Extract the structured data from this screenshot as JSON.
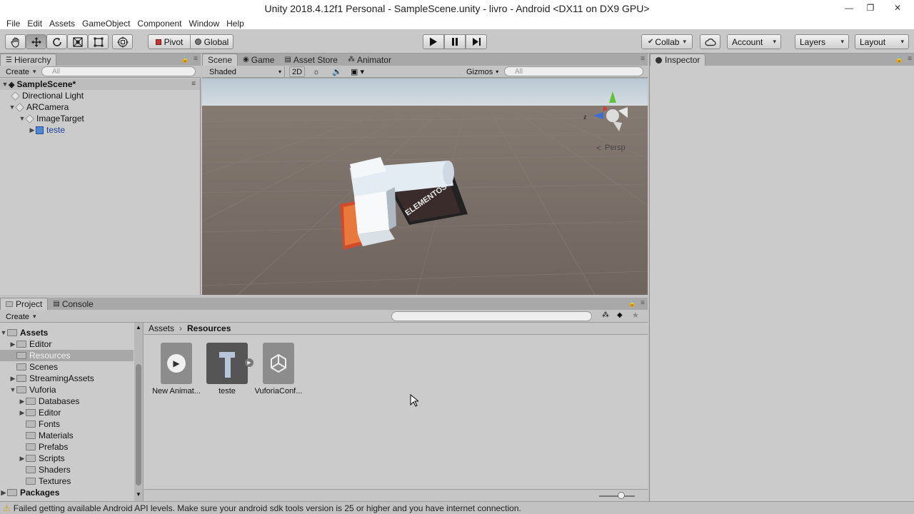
{
  "window": {
    "title": "Unity 2018.4.12f1 Personal - SampleScene.unity - livro - Android <DX11 on DX9 GPU>",
    "controls": [
      "—",
      "❐",
      "✕"
    ]
  },
  "menu": [
    "File",
    "Edit",
    "Assets",
    "GameObject",
    "Component",
    "Window",
    "Help"
  ],
  "toolbar": {
    "pivot_label": "Pivot",
    "global_label": "Global",
    "collab_label": "Collab",
    "account_label": "Account",
    "layers_label": "Layers",
    "layout_label": "Layout"
  },
  "hierarchy": {
    "tab_label": "Hierarchy",
    "create_label": "Create",
    "search_placeholder": "All",
    "scene_name": "SampleScene*",
    "items": [
      {
        "label": "Directional Light"
      },
      {
        "label": "ARCamera"
      },
      {
        "label": "ImageTarget"
      },
      {
        "label": "teste"
      }
    ]
  },
  "scene": {
    "tabs": [
      "Scene",
      "Game",
      "Asset Store",
      "Animator"
    ],
    "shading_mode": "Shaded",
    "mode_2d": "2D",
    "gizmos_label": "Gizmos",
    "search_placeholder": "All",
    "persp_label": "Persp",
    "target_text": "ELEMENTOS"
  },
  "inspector": {
    "tab_label": "Inspector"
  },
  "project": {
    "tabs": [
      "Project",
      "Console"
    ],
    "create_label": "Create",
    "breadcrumb": [
      "Assets",
      "Resources"
    ],
    "tree": [
      {
        "label": "Assets"
      },
      {
        "label": "Editor"
      },
      {
        "label": "Resources"
      },
      {
        "label": "Scenes"
      },
      {
        "label": "StreamingAssets"
      },
      {
        "label": "Vuforia"
      },
      {
        "label": "Databases"
      },
      {
        "label": "Editor"
      },
      {
        "label": "Fonts"
      },
      {
        "label": "Materials"
      },
      {
        "label": "Prefabs"
      },
      {
        "label": "Scripts"
      },
      {
        "label": "Shaders"
      },
      {
        "label": "Textures"
      },
      {
        "label": "Packages"
      }
    ],
    "assets": [
      {
        "label": "New Animat...",
        "icon": "animation-clip-icon"
      },
      {
        "label": "teste",
        "icon": "prefab-model-icon"
      },
      {
        "label": "VuforiaConf...",
        "icon": "unity-logo-icon"
      }
    ]
  },
  "status": {
    "message": "Failed getting available Android API levels. Make sure your android sdk tools version is 25 or higher and you have internet connection."
  },
  "colors": {
    "accent_selected": "#8fb0d9",
    "scene_sky": "#c9d4dd",
    "scene_ground": "#7b706a",
    "warning": "#e0b020"
  }
}
